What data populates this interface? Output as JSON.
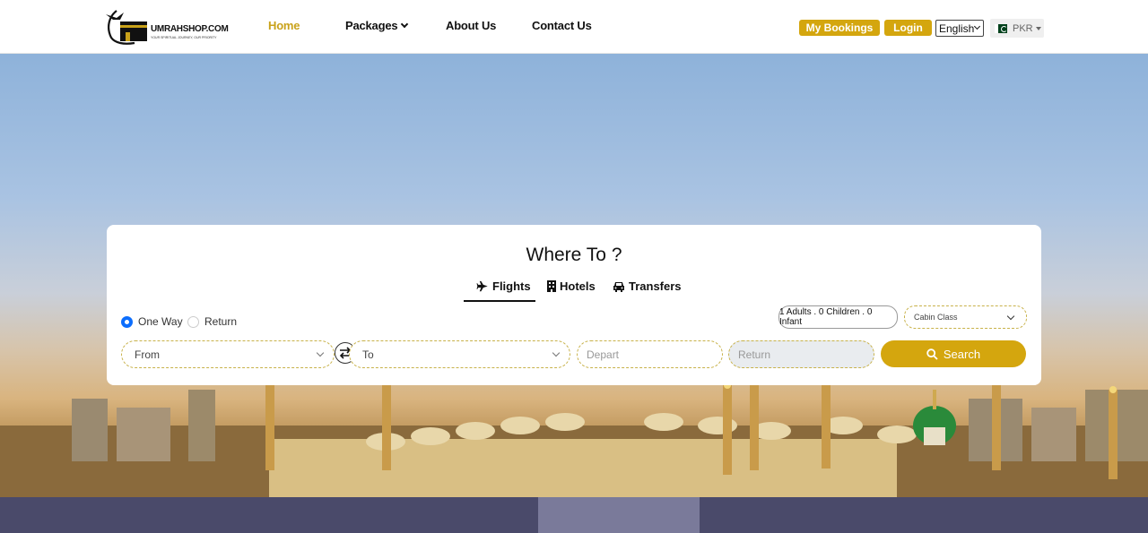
{
  "brand": {
    "logo_text": "UMRAHSHOP.COM",
    "tagline": "YOUR SPIRITUAL JOURNEY, OUR PRIORITY"
  },
  "nav": {
    "home": "Home",
    "packages": "Packages",
    "about": "About Us",
    "contact": "Contact Us"
  },
  "header_actions": {
    "my_bookings": "My Bookings",
    "login": "Login",
    "language": "English",
    "currency": "PKR"
  },
  "search": {
    "title": "Where To ?",
    "tabs": [
      {
        "label": "Flights",
        "icon": "plane-icon",
        "active": true
      },
      {
        "label": "Hotels",
        "icon": "building-icon",
        "active": false
      },
      {
        "label": "Transfers",
        "icon": "car-icon",
        "active": false
      }
    ],
    "trip_types": [
      {
        "label": "One Way",
        "selected": true
      },
      {
        "label": "Return",
        "selected": false
      }
    ],
    "passengers": "1 Adults . 0 Children . 0 Infant",
    "cabin_class": "Cabin Class",
    "from_placeholder": "From",
    "to_placeholder": "To",
    "depart_placeholder": "Depart",
    "return_placeholder": "Return",
    "search_button": "Search"
  },
  "colors": {
    "accent": "#d4a60e",
    "active_nav": "#c9a21a",
    "radio": "#0d6efd"
  }
}
